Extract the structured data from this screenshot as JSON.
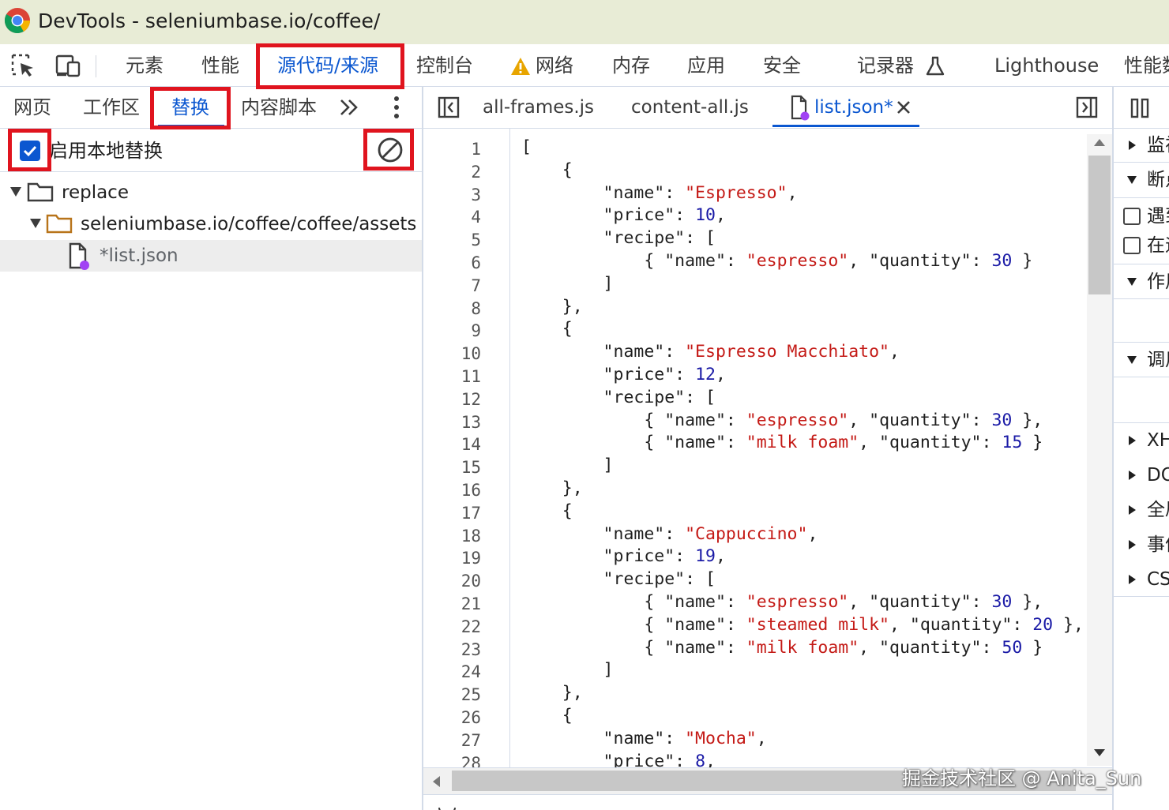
{
  "window": {
    "title": "DevTools - seleniumbase.io/coffee/"
  },
  "main_tabs": [
    "元素",
    "性能",
    "源代码/来源",
    "控制台",
    "网络",
    "内存",
    "应用",
    "安全",
    "记录器",
    "Lighthouse",
    "性能数"
  ],
  "navigator": {
    "tabs": [
      "网页",
      "工作区",
      "替换",
      "内容脚本"
    ],
    "enable_overrides_label": "启用本地替换",
    "tree": {
      "root": "replace",
      "folder": "seleniumbase.io/coffee/coffee/assets",
      "file": "*list.json"
    }
  },
  "editor": {
    "tabs": [
      "all-frames.js",
      "content-all.js",
      "list.json*"
    ],
    "line_numbers": [
      "1",
      "2",
      "3",
      "4",
      "5",
      "6",
      "7",
      "8",
      "9",
      "10",
      "11",
      "12",
      "13",
      "14",
      "15",
      "16",
      "17",
      "18",
      "19",
      "20",
      "21",
      "22",
      "23",
      "24",
      "25",
      "26",
      "27",
      "28"
    ],
    "keys": {
      "name": "\"name\"",
      "price": "\"price\"",
      "recipe": "\"recipe\"",
      "quantity": "\"quantity\""
    },
    "coffees": [
      {
        "name": "\"Espresso\"",
        "price": "10",
        "recipe": [
          {
            "name": "\"espresso\"",
            "quantity": "30"
          }
        ]
      },
      {
        "name": "\"Espresso Macchiato\"",
        "price": "12",
        "recipe": [
          {
            "name": "\"espresso\"",
            "quantity": "30"
          },
          {
            "name": "\"milk foam\"",
            "quantity": "15"
          }
        ]
      },
      {
        "name": "\"Cappuccino\"",
        "price": "19",
        "recipe": [
          {
            "name": "\"espresso\"",
            "quantity": "30"
          },
          {
            "name": "\"steamed milk\"",
            "quantity": "20"
          },
          {
            "name": "\"milk foam\"",
            "quantity": "50"
          }
        ]
      },
      {
        "name": "\"Mocha\"",
        "price": "8"
      }
    ]
  },
  "debugger_pane": {
    "items": [
      "监视",
      "断点",
      "遇到未捕获的异常时暂停",
      "在遇到异常时暂停",
      "作用域",
      "调用堆栈",
      "XHR/提取断点",
      "DOM 断点",
      "全局监听器",
      "事件监听器断点",
      "CSP 违规断点"
    ]
  },
  "watermark": "掘金技术社区 @ Anita_Sun",
  "colors": {
    "accent": "#0b57d0",
    "highlight_box": "#e0141e",
    "string": "#c41a16",
    "number": "#1a1aa6"
  }
}
